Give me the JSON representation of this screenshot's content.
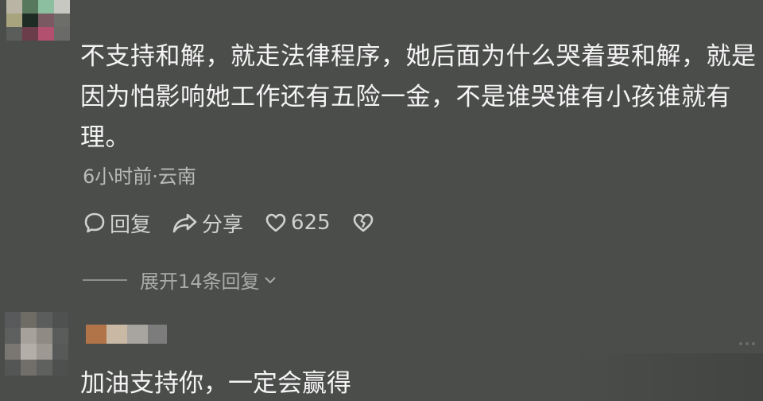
{
  "comment_1": {
    "text": "不支持和解，就走法律程序，她后面为什么哭着要和解，就是因为怕影响她工作还有五险一金，不是谁哭谁有小孩谁就有理。",
    "meta": "6小时前·云南",
    "actions": {
      "reply_label": "回复",
      "share_label": "分享",
      "like_count": "625"
    },
    "expand_label": "展开14条回复"
  },
  "comment_2": {
    "text": "加油支持你，一定会赢得"
  },
  "icons": {
    "reply": "comment-bubble-icon",
    "share": "share-arrow-icon",
    "like": "heart-icon",
    "dislike": "broken-heart-icon",
    "expand": "chevron-down-icon"
  },
  "colors": {
    "background": "#4b4d4b",
    "text": "#f4f4f4",
    "meta": "#b9bbb9"
  }
}
